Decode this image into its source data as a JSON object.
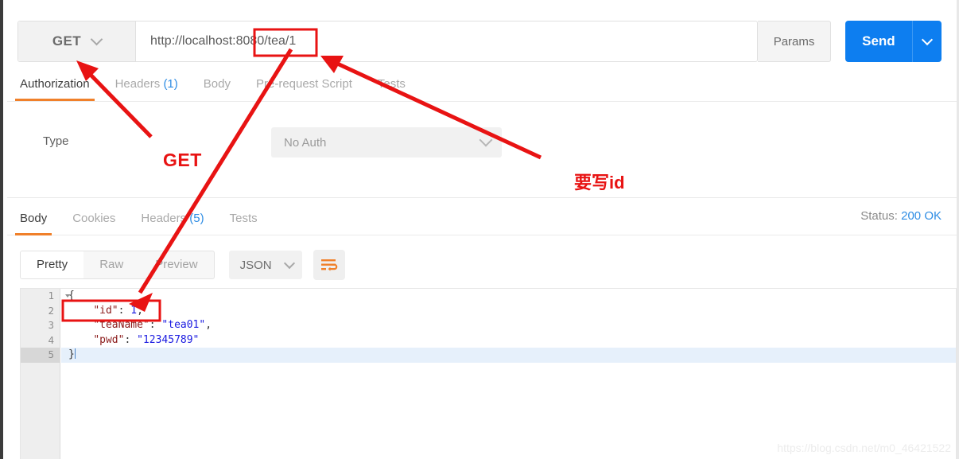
{
  "request": {
    "method": "GET",
    "url": "http://localhost:8080/tea/1",
    "params_label": "Params",
    "send_label": "Send",
    "tabs": [
      {
        "label": "Authorization",
        "badge": "",
        "active": true
      },
      {
        "label": "Headers",
        "badge": "(1)",
        "active": false
      },
      {
        "label": "Body",
        "badge": "",
        "active": false
      },
      {
        "label": "Pre-request Script",
        "badge": "",
        "active": false
      },
      {
        "label": "Tests",
        "badge": "",
        "active": false
      }
    ]
  },
  "auth": {
    "type_label": "Type",
    "type_value": "No Auth"
  },
  "response": {
    "tabs": [
      {
        "label": "Body",
        "badge": "",
        "active": true
      },
      {
        "label": "Cookies",
        "badge": "",
        "active": false
      },
      {
        "label": "Headers",
        "badge": "(5)",
        "active": false
      },
      {
        "label": "Tests",
        "badge": "",
        "active": false
      }
    ],
    "status_label": "Status:",
    "status_value": "200 OK",
    "view_modes": [
      {
        "label": "Pretty",
        "active": true
      },
      {
        "label": "Raw",
        "active": false
      },
      {
        "label": "Preview",
        "active": false
      }
    ],
    "format": "JSON",
    "wrap_icon": "word-wrap-icon",
    "body_lines": [
      {
        "num": "1",
        "fold": true,
        "current": false,
        "tokens": [
          {
            "t": "{",
            "c": "p"
          }
        ]
      },
      {
        "num": "2",
        "fold": false,
        "current": false,
        "tokens": [
          {
            "t": "    ",
            "c": "p"
          },
          {
            "t": "\"id\"",
            "c": "k"
          },
          {
            "t": ": ",
            "c": "p"
          },
          {
            "t": "1",
            "c": "n"
          },
          {
            "t": ",",
            "c": "p"
          }
        ]
      },
      {
        "num": "3",
        "fold": false,
        "current": false,
        "tokens": [
          {
            "t": "    ",
            "c": "p"
          },
          {
            "t": "\"teaName\"",
            "c": "k"
          },
          {
            "t": ": ",
            "c": "p"
          },
          {
            "t": "\"tea01\"",
            "c": "s"
          },
          {
            "t": ",",
            "c": "p"
          }
        ]
      },
      {
        "num": "4",
        "fold": false,
        "current": false,
        "tokens": [
          {
            "t": "    ",
            "c": "p"
          },
          {
            "t": "\"pwd\"",
            "c": "k"
          },
          {
            "t": ": ",
            "c": "p"
          },
          {
            "t": "\"12345789\"",
            "c": "s"
          }
        ]
      },
      {
        "num": "5",
        "fold": false,
        "current": true,
        "tokens": [
          {
            "t": "}",
            "c": "p"
          }
        ]
      }
    ]
  },
  "annotations": {
    "get_note": "GET",
    "id_note": "要写id",
    "color": "#e81313"
  },
  "watermark": "https://blog.csdn.net/m0_46421522",
  "theme": {
    "accent_orange": "#f0802a",
    "send_blue": "#0d7ef0",
    "status_blue": "#2f8de4"
  }
}
